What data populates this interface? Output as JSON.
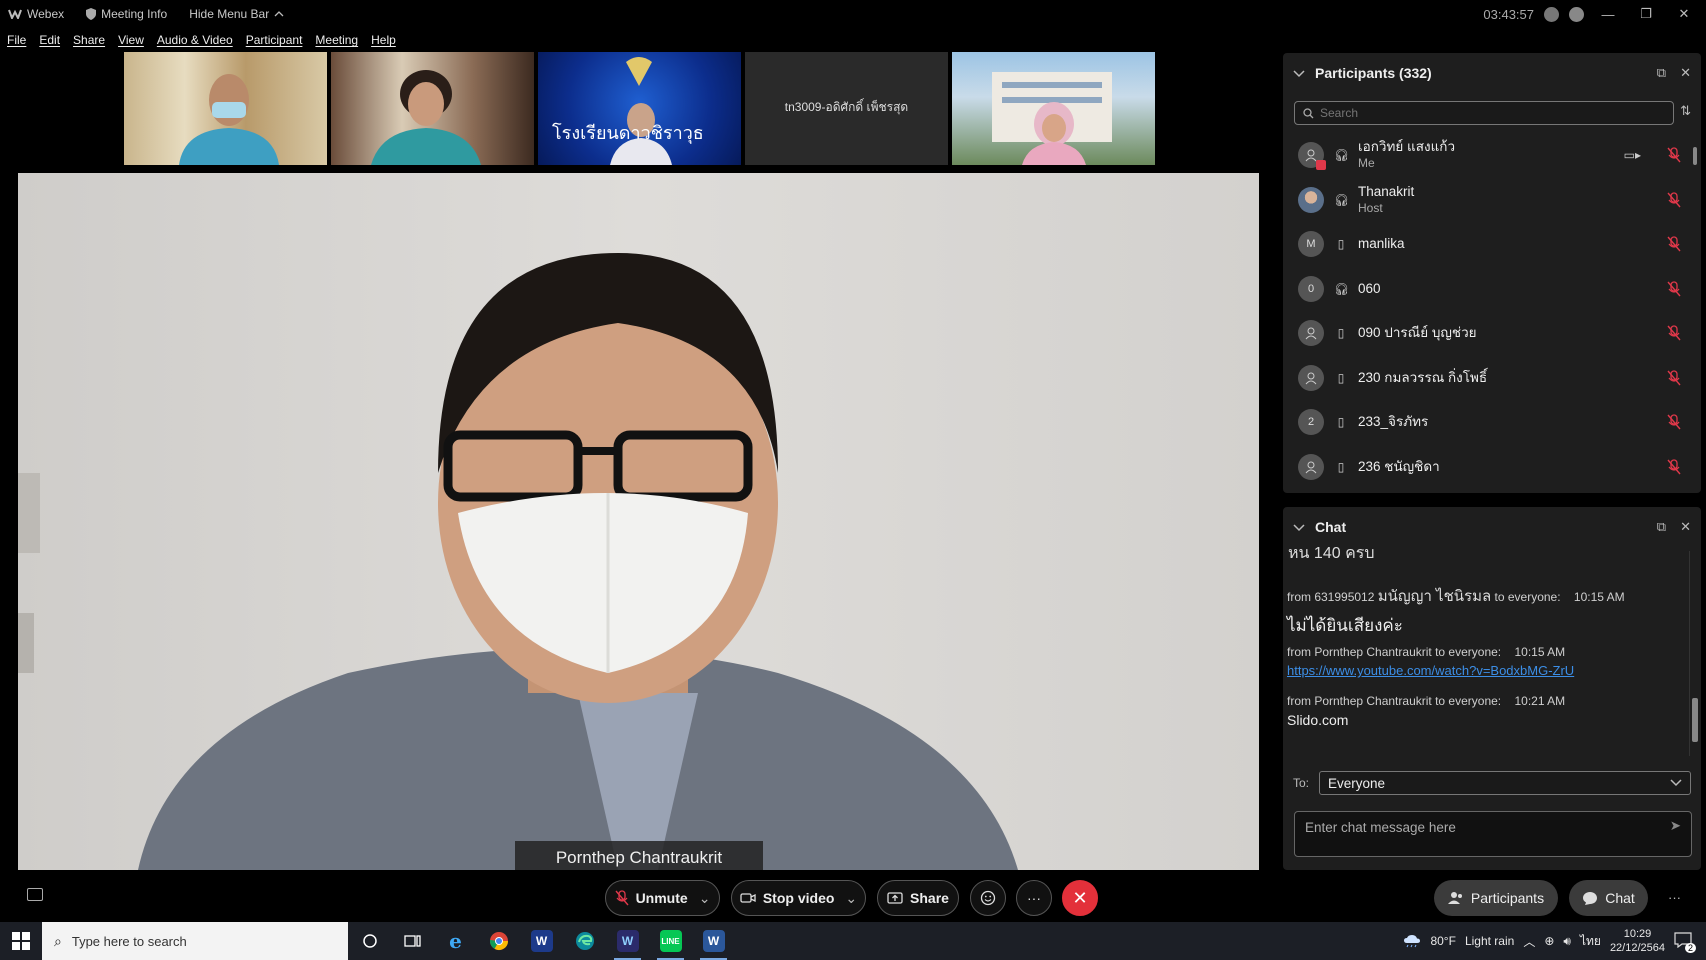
{
  "titlebar": {
    "app_name": "Webex",
    "meeting_info": "Meeting Info",
    "hide_menu": "Hide Menu Bar",
    "timer": "03:43:57"
  },
  "menu": [
    "File",
    "Edit",
    "Share",
    "View",
    "Audio & Video",
    "Participant",
    "Meeting",
    "Help"
  ],
  "thumbnails": [
    {
      "label": ""
    },
    {
      "label": ""
    },
    {
      "label": "โรงเรียนดาวชิราวุธ"
    },
    {
      "label": "tn3009-อดิศักดิ์ เพ็ชรสุด"
    },
    {
      "label": ""
    }
  ],
  "main_video": {
    "speaker_name": "Pornthep Chantraukrit"
  },
  "participants": {
    "title": "Participants (332)",
    "search_placeholder": "Search",
    "list": [
      {
        "name": "เอกวิทย์ แสงแก้ว",
        "role": "Me",
        "avatar": "",
        "device": "headset",
        "video": true
      },
      {
        "name": "Thanakrit",
        "role": "Host",
        "avatar": "",
        "device": "headset",
        "video": false
      },
      {
        "name": "manlika",
        "role": "",
        "avatar": "M",
        "device": "phone",
        "video": false
      },
      {
        "name": "060",
        "role": "",
        "avatar": "0",
        "device": "headset",
        "video": false
      },
      {
        "name": "090 ปารณีย์ บุญช่วย",
        "role": "",
        "avatar": "",
        "device": "phone",
        "video": false
      },
      {
        "name": "230 กมลวรรณ กิ่งโพธิ์",
        "role": "",
        "avatar": "",
        "device": "phone",
        "video": false
      },
      {
        "name": "233_จิรภัทร",
        "role": "",
        "avatar": "2",
        "device": "phone",
        "video": false
      },
      {
        "name": "236 ชนัญชิดา",
        "role": "",
        "avatar": "",
        "device": "phone",
        "video": false
      }
    ]
  },
  "chat": {
    "title": "Chat",
    "cut_line": "หน 140 ครบ",
    "messages": [
      {
        "from": "from 631995012",
        "sender_thai": "มนัญญา ไชนิรมล",
        "to": "to everyone:",
        "time": "10:15 AM",
        "text": "ไม่ได้ยินเสียงค่ะ",
        "link": ""
      },
      {
        "from": "from Pornthep Chantraukrit",
        "sender_thai": "",
        "to": "to everyone:",
        "time": "10:15 AM",
        "text": "",
        "link": "https://www.youtube.com/watch?v=BodxbMG-ZrU"
      },
      {
        "from": "from Pornthep Chantraukrit",
        "sender_thai": "",
        "to": "to everyone:",
        "time": "10:21 AM",
        "text": "Slido.com",
        "link": ""
      }
    ],
    "to_label": "To:",
    "to_value": "Everyone",
    "input_placeholder": "Enter chat message here"
  },
  "controls": {
    "unmute": "Unmute",
    "stop_video": "Stop video",
    "share": "Share",
    "participants": "Participants",
    "chat": "Chat"
  },
  "taskbar": {
    "search_placeholder": "Type here to search",
    "weather_temp": "80°F",
    "weather_text": "Light rain",
    "lang": "ไทย",
    "time": "10:29",
    "date": "22/12/2564",
    "notif_count": "2"
  },
  "colors": {
    "end_call": "#e3303a",
    "link": "#3c8ee6",
    "mute_red": "#e0384a"
  }
}
